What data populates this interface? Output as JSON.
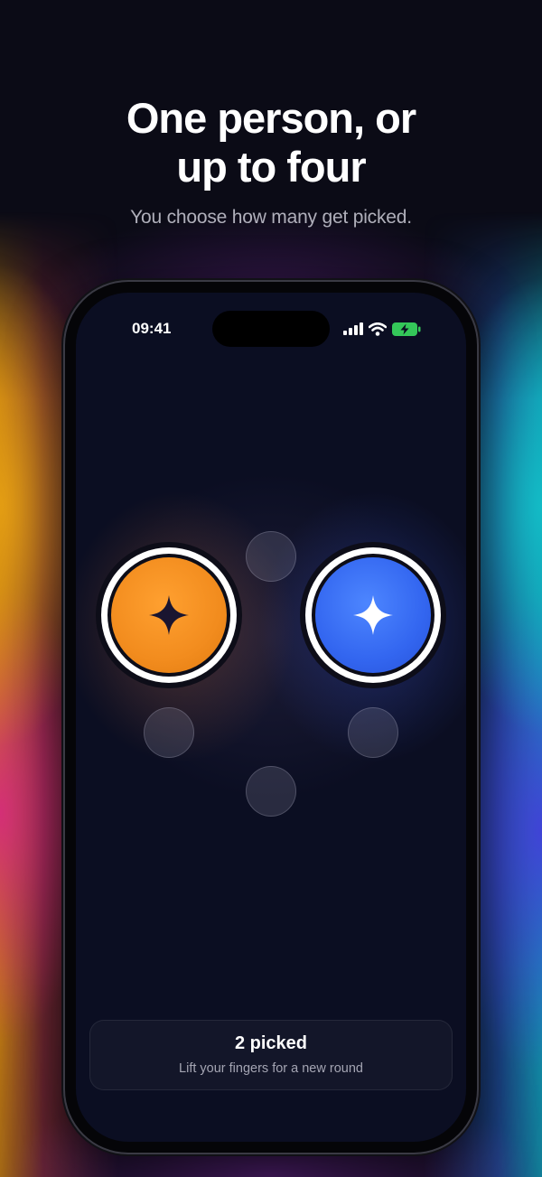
{
  "headline": {
    "line1": "One person, or",
    "line2": "up to four"
  },
  "subheadline": "You choose how many get picked.",
  "status_bar": {
    "time": "09:41",
    "icons": [
      "cellular-signal-icon",
      "wifi-icon",
      "battery-charging-icon"
    ],
    "battery_color": "#34c759"
  },
  "picker": {
    "picked_count": 2,
    "picked_colors": [
      "#f28c1e",
      "#3366f0"
    ],
    "empty_slot_count": 4
  },
  "result_card": {
    "title": "2 picked",
    "caption": "Lift your fingers for a new round"
  },
  "colors": {
    "background": "#0b0b16",
    "screen": "#0b0e22",
    "orange": "#f28c1e",
    "blue": "#3366f0"
  }
}
